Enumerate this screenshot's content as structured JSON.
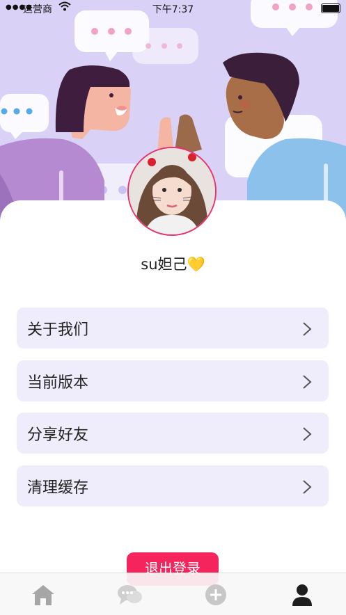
{
  "status_bar": {
    "signal": "●●●●",
    "carrier": "运营商",
    "time": "下午7:37"
  },
  "profile": {
    "name": "su妲己",
    "emoji": "💛"
  },
  "menu": [
    {
      "label": "关于我们"
    },
    {
      "label": "当前版本"
    },
    {
      "label": "分享好友"
    },
    {
      "label": "清理缓存"
    }
  ],
  "logout": {
    "label": "退出登录"
  },
  "tabs": [
    {
      "icon": "home-icon"
    },
    {
      "icon": "chat-bubbles-icon"
    },
    {
      "icon": "plus-circle-icon"
    },
    {
      "icon": "person-icon",
      "active": true
    }
  ],
  "colors": {
    "hero_bg": "#d9d2f6",
    "menu_bg": "#efedfb",
    "accent": "#f5245c",
    "avatar_border": "#e8336e"
  }
}
